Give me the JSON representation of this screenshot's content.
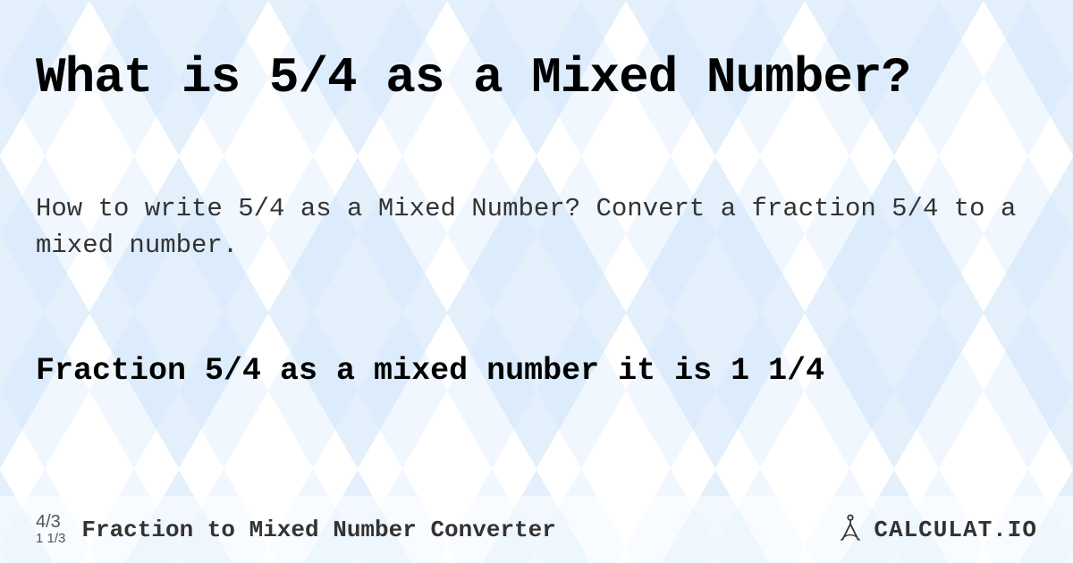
{
  "title": "What is 5/4 as a Mixed Number?",
  "description": "How to write 5/4 as a Mixed Number? Convert a fraction 5/4 to a mixed number.",
  "answer": "Fraction 5/4 as a mixed number it is 1 1/4",
  "footer": {
    "icon_top": "4/3",
    "icon_bottom": "1 1/3",
    "label": "Fraction to Mixed Number Converter",
    "brand": "CALCULAT.IO"
  }
}
